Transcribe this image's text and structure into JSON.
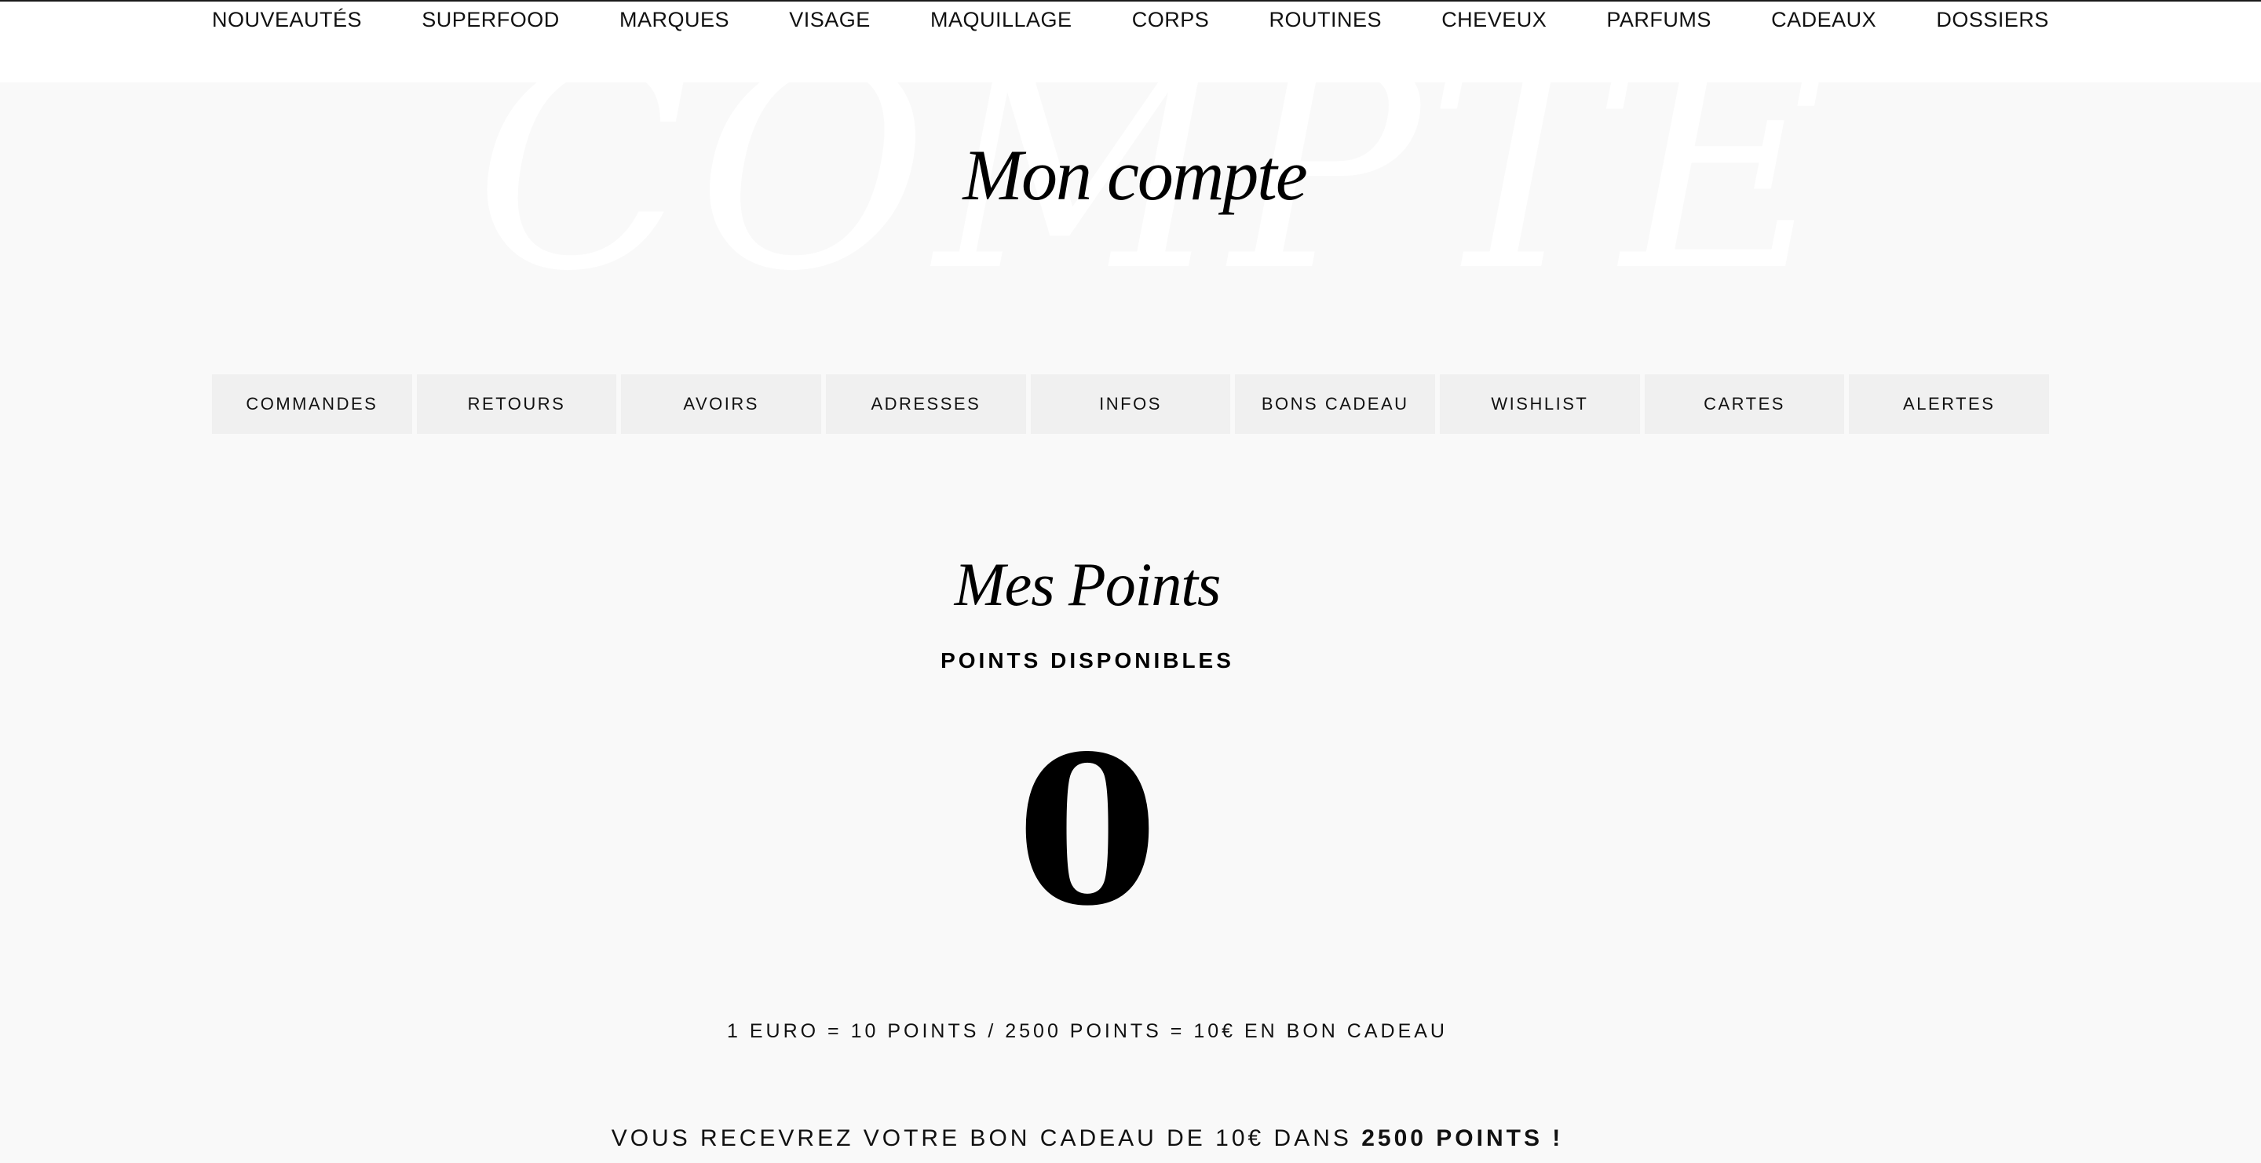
{
  "nav": {
    "items": [
      {
        "label": "NOUVEAUTÉS"
      },
      {
        "label": "SUPERFOOD"
      },
      {
        "label": "MARQUES"
      },
      {
        "label": "VISAGE"
      },
      {
        "label": "MAQUILLAGE"
      },
      {
        "label": "CORPS"
      },
      {
        "label": "ROUTINES"
      },
      {
        "label": "CHEVEUX"
      },
      {
        "label": "PARFUMS"
      },
      {
        "label": "CADEAUX"
      },
      {
        "label": "DOSSIERS"
      }
    ]
  },
  "hero": {
    "background_word": "COMPTE",
    "title": "Mon compte"
  },
  "tabs": [
    {
      "label": "COMMANDES"
    },
    {
      "label": "RETOURS"
    },
    {
      "label": "AVOIRS"
    },
    {
      "label": "ADRESSES"
    },
    {
      "label": "INFOS"
    },
    {
      "label": "BONS CADEAU"
    },
    {
      "label": "WISHLIST"
    },
    {
      "label": "CARTES"
    },
    {
      "label": "ALERTES"
    }
  ],
  "points": {
    "title": "Mes Points",
    "label": "POINTS DISPONIBLES",
    "value": "0",
    "rate": "1 EURO = 10 POINTS / 2500 POINTS = 10€ EN BON CADEAU",
    "voucher_prefix": "VOUS RECEVREZ VOTRE BON CADEAU DE 10€ DANS ",
    "voucher_points": "2500 POINTS !"
  }
}
